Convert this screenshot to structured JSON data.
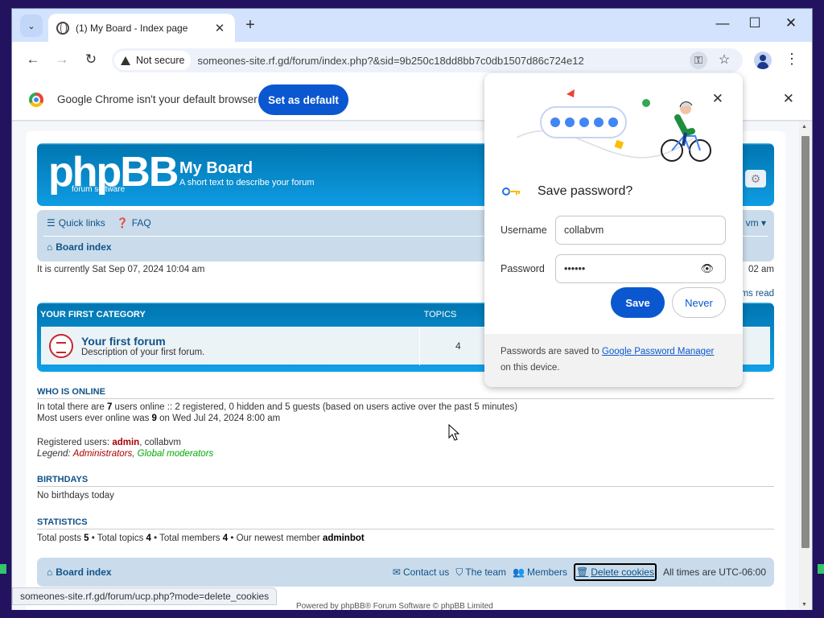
{
  "browser": {
    "tab_title": "(1) My Board - Index page",
    "tab_close": "✕",
    "new_tab": "+",
    "minimize": "—",
    "maximize": "☐",
    "close": "✕",
    "not_secure": "Not secure",
    "url": "someones-site.rf.gd/forum/index.php?&sid=9b250c18dd8bb7c0db1507d86c724e12",
    "status_url": "someones-site.rf.gd/forum/ucp.php?mode=delete_cookies"
  },
  "infobar": {
    "message": "Google Chrome isn't your default browser",
    "button": "Set as default"
  },
  "forum": {
    "logo": "phpBB",
    "logo_sub": "forum      software",
    "site_title": "My Board",
    "site_desc": "A short text to describe your forum",
    "quick_links": "Quick links",
    "faq": "FAQ",
    "board_index": "Board index",
    "nav_right": "vm ▾",
    "currently": "It is currently Sat Sep 07, 2024 10:04 am",
    "last_visit": "02 am",
    "mark_read": "ms read",
    "category": "YOUR FIRST CATEGORY",
    "topics_label": "TOPICS",
    "forum_name": "Your first forum",
    "forum_desc": "Description of your first forum.",
    "topics_count": "4",
    "who_online_h": "WHO IS ONLINE",
    "birthdays_h": "BIRTHDAYS",
    "birthdays_t": "No birthdays today",
    "stats_h": "STATISTICS",
    "registered_label": "Registered users:",
    "registered_admin": "admin",
    "registered_rest": ", collabvm",
    "legend_label": "Legend:",
    "legend_admins": "Administrators",
    "legend_sep": ", ",
    "legend_mods": "Global moderators",
    "footer": {
      "board_index": "Board index",
      "contact": "Contact us",
      "team": "The team",
      "members": "Members",
      "delete_cookies": "Delete cookies",
      "timezone": "All times are UTC-06:00"
    },
    "powered": "Powered by phpBB® Forum Software © phpBB Limited"
  },
  "password_popup": {
    "title": "Save password?",
    "username_label": "Username",
    "username": "collabvm",
    "password_label": "Password",
    "password": "••••••",
    "save": "Save",
    "never": "Never",
    "footer_text": "Passwords are saved to",
    "footer_link": "Google Password Manager",
    "footer_text2": "on this device."
  }
}
